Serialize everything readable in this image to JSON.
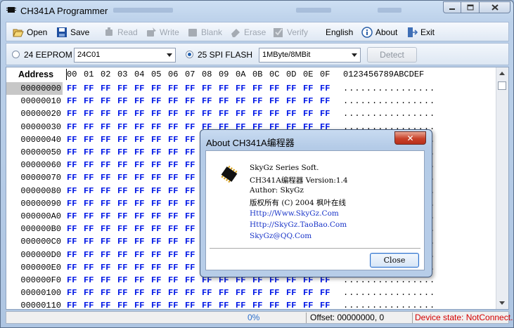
{
  "window": {
    "title": "CH341A Programmer"
  },
  "toolbar": {
    "open": "Open",
    "save": "Save",
    "read": "Read",
    "write": "Write",
    "blank": "Blank",
    "erase": "Erase",
    "verify": "Verify",
    "language": "English",
    "about": "About",
    "exit": "Exit"
  },
  "options": {
    "eeprom_label": "24 EEPROM",
    "eeprom_selected": false,
    "eeprom_model": "24C01",
    "spi_label": "25 SPI FLASH",
    "spi_selected": true,
    "spi_size": "1MByte/8MBit",
    "detect": "Detect"
  },
  "hex": {
    "header_address": "Address",
    "columns": [
      "00",
      "01",
      "02",
      "03",
      "04",
      "05",
      "06",
      "07",
      "08",
      "09",
      "0A",
      "0B",
      "0C",
      "0D",
      "0E",
      "0F"
    ],
    "ascii_header": "0123456789ABCDEF",
    "rows": [
      "00000000",
      "00000010",
      "00000020",
      "00000030",
      "00000040",
      "00000050",
      "00000060",
      "00000070",
      "00000080",
      "00000090",
      "000000A0",
      "000000B0",
      "000000C0",
      "000000D0",
      "000000E0",
      "000000F0",
      "00000100",
      "00000110"
    ],
    "byte_value": "FF",
    "ascii_value": "................"
  },
  "status": {
    "progress": "0%",
    "offset": "Offset: 00000000, 0",
    "device_state": "Device state: NotConnect.",
    "device_state_color": "#d40000"
  },
  "about_dialog": {
    "title": "About CH341A编程器",
    "lines": [
      "SkyGz Series Soft.",
      "CH341A编程器 Version:1.4",
      "Author: SkyGz",
      "版权所有 (C) 2004 枫叶在线"
    ],
    "links": [
      "Http://Www.SkyGz.Com",
      "Http://SkyGz.TaoBao.Com",
      "SkyGz@QQ.Com"
    ],
    "close_button": "Close"
  }
}
